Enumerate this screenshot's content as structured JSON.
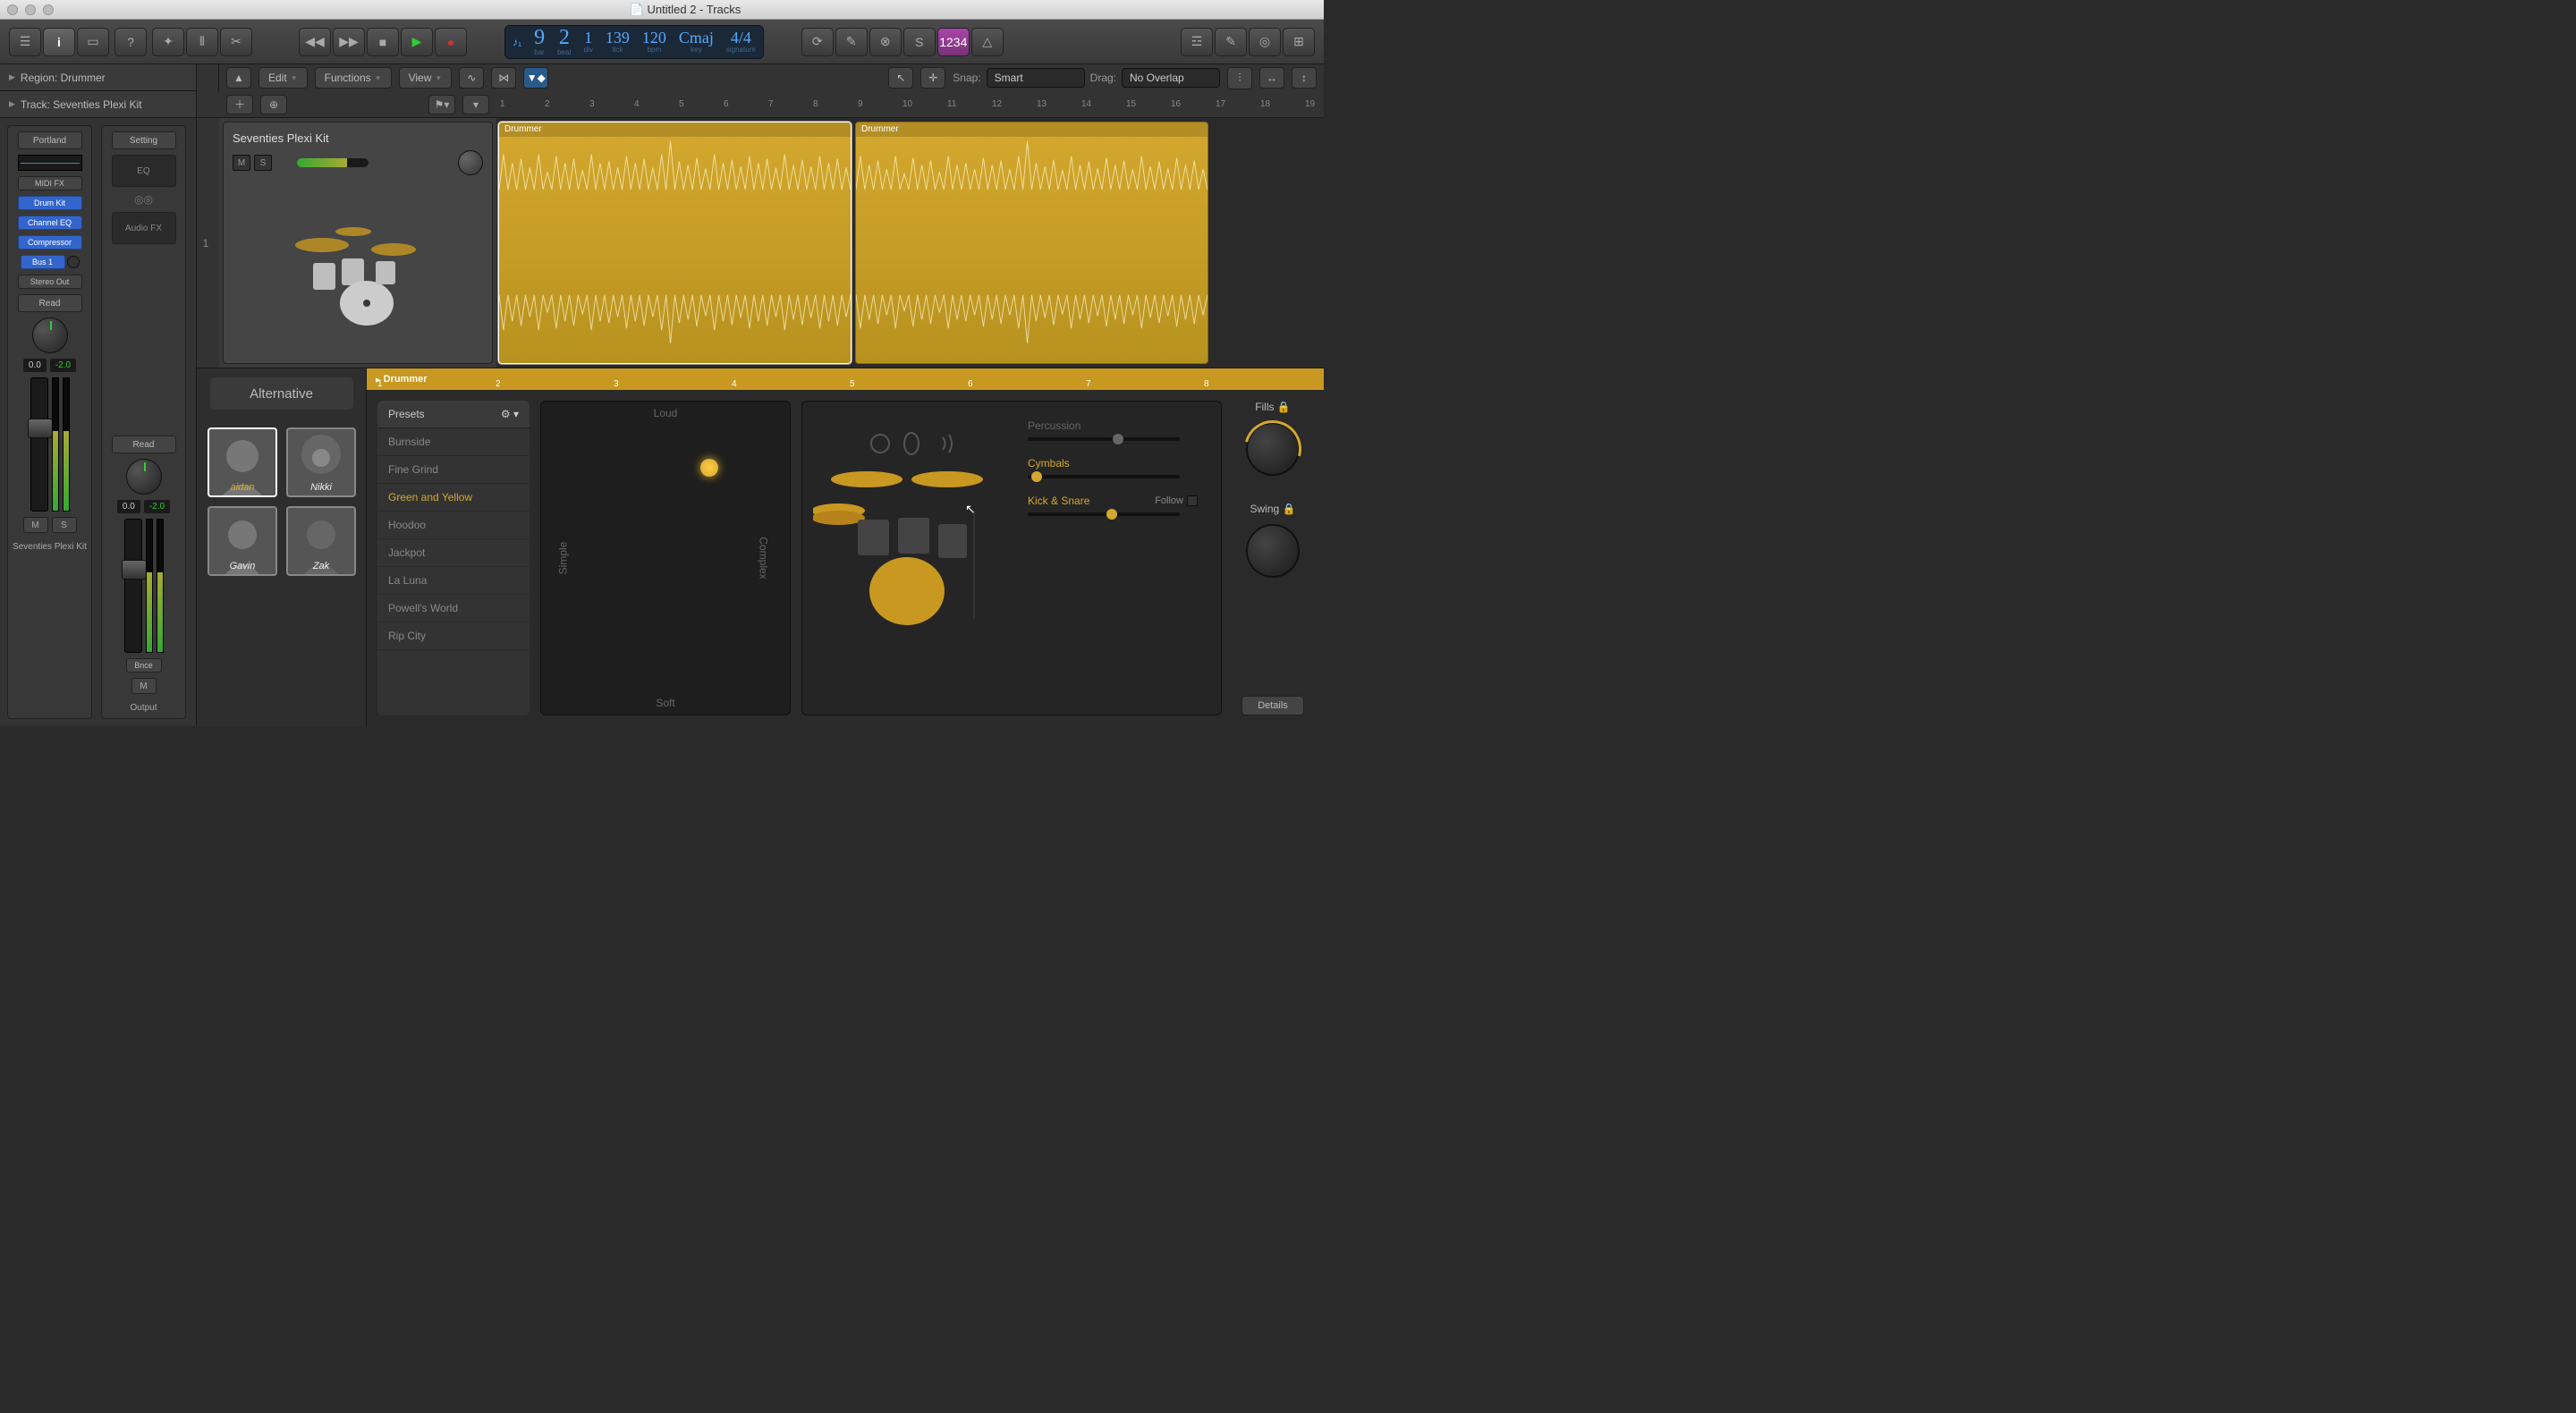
{
  "window_title": "Untitled 2 - Tracks",
  "inspector": {
    "region_label": "Region: Drummer",
    "track_label": "Track:  Seventies Plexi Kit"
  },
  "transport": {
    "bar": "9",
    "beat": "2",
    "div": "1",
    "tick": "139",
    "bpm": "120",
    "key": "Cmaj",
    "signature": "4/4",
    "labels": {
      "bar": "bar",
      "beat": "beat",
      "div": "div",
      "tick": "tick",
      "bpm": "bpm",
      "key": "key",
      "signature": "signature"
    }
  },
  "editbar": {
    "edit": "Edit",
    "functions": "Functions",
    "view": "View",
    "snap_label": "Snap:",
    "snap_value": "Smart",
    "drag_label": "Drag:",
    "drag_value": "No Overlap"
  },
  "channel1": {
    "preset": "Portland",
    "midifx": "MIDI FX",
    "drumkit": "Drum Kit",
    "channeleq": "Channel EQ",
    "compressor": "Compressor",
    "bus": "Bus 1",
    "stereo": "Stereo Out",
    "read": "Read",
    "val1": "0.0",
    "val2": "-2.0",
    "m": "M",
    "s": "S",
    "name": "Seventies Plexi Kit"
  },
  "channel2": {
    "setting": "Setting",
    "eq": "EQ",
    "audiofx": "Audio FX",
    "read": "Read",
    "val1": "0.0",
    "val2": "-2.0",
    "bnce": "Bnce",
    "m": "M",
    "name": "Output"
  },
  "track": {
    "title": "Seventies Plexi Kit",
    "m": "M",
    "s": "S",
    "num": "1"
  },
  "ruler_marks": [
    "1",
    "2",
    "3",
    "4",
    "5",
    "6",
    "7",
    "8",
    "9",
    "10",
    "11",
    "12",
    "13",
    "14",
    "15",
    "16",
    "17",
    "18",
    "19"
  ],
  "region1_title": "Drummer",
  "region2_title": "Drummer",
  "drummer": {
    "alternative": "Alternative",
    "ruler_title": "Drummer",
    "ruler_marks": [
      "1",
      "2",
      "3",
      "4",
      "5",
      "6",
      "7",
      "8"
    ],
    "presets_header": "Presets",
    "presets": [
      "Burnside",
      "Fine Grind",
      "Green and Yellow",
      "Hoodoo",
      "Jackpot",
      "La Luna",
      "Powell's World",
      "Rip City"
    ],
    "preset_selected": "Green and Yellow",
    "xy": {
      "loud": "Loud",
      "soft": "Soft",
      "simple": "Simple",
      "complex": "Complex"
    },
    "controls": {
      "percussion": "Percussion",
      "cymbals": "Cymbals",
      "kicksnare": "Kick & Snare",
      "follow": "Follow",
      "fills": "Fills",
      "swing": "Swing",
      "details": "Details"
    }
  },
  "toolbar_right_tag": "1234"
}
